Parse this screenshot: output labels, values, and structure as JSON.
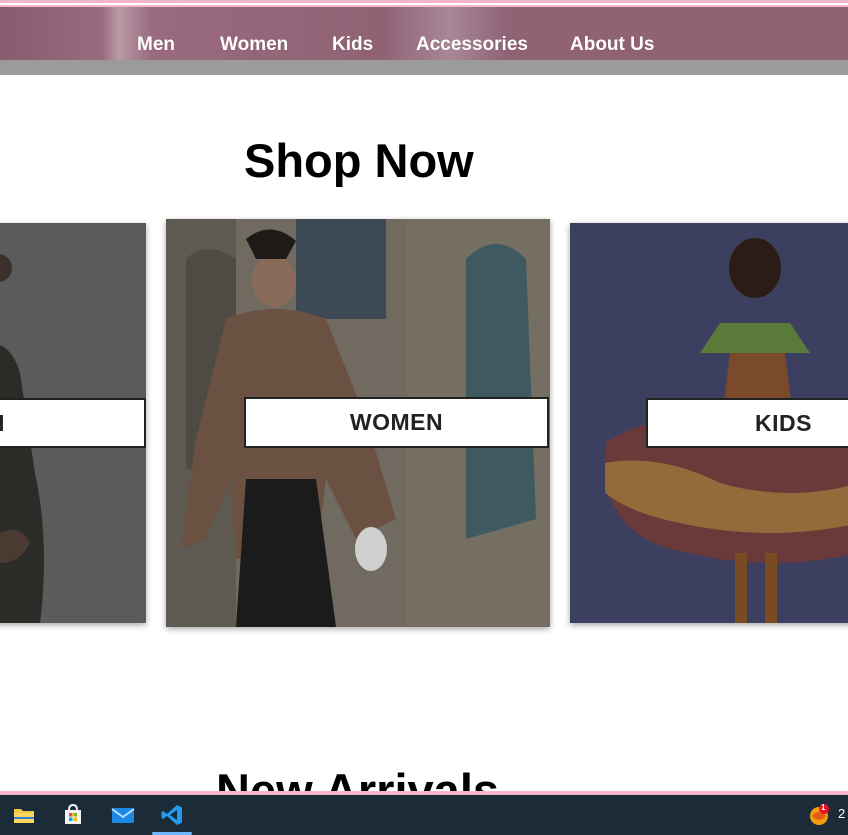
{
  "nav": {
    "items": [
      {
        "label": "Men"
      },
      {
        "label": "Women"
      },
      {
        "label": "Kids"
      },
      {
        "label": "Accessories"
      },
      {
        "label": "About Us"
      }
    ]
  },
  "shop": {
    "title": "Shop Now",
    "cards": [
      {
        "label": "EN"
      },
      {
        "label": "WOMEN"
      },
      {
        "label": "KIDS"
      }
    ]
  },
  "arrivals": {
    "title": "New Arrivals"
  },
  "taskbar": {
    "apps": [
      {
        "name": "File Explorer",
        "icon": "folder-icon"
      },
      {
        "name": "Microsoft Store",
        "icon": "store-icon"
      },
      {
        "name": "Mail",
        "icon": "mail-icon"
      },
      {
        "name": "Visual Studio Code",
        "icon": "vscode-icon"
      }
    ],
    "tray": {
      "badge_count": "1",
      "clock_partial": "2"
    }
  },
  "colors": {
    "accent_pink": "#f4b6cc",
    "nav_overlay": "#8f6274",
    "taskbar": "#1c2b38"
  }
}
